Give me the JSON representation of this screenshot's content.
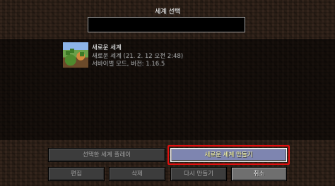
{
  "screen": {
    "title": "세계 선택"
  },
  "search": {
    "value": "",
    "placeholder": ""
  },
  "worlds": [
    {
      "name": "새로운 세계",
      "meta_line1": "새로운 세계 (21. 2. 12 오전 2:48)",
      "meta_line2": "서바이벌 모드, 버전: 1.16.5"
    }
  ],
  "buttons": {
    "play_selected": "선택한 세계 플레이",
    "create_new": "새로운 세계 만들기",
    "edit": "편집",
    "delete": "삭제",
    "recreate": "다시 만들기",
    "cancel": "취소"
  },
  "colors": {
    "highlight": "#e01010",
    "dirt_background": "#2a1e16"
  }
}
